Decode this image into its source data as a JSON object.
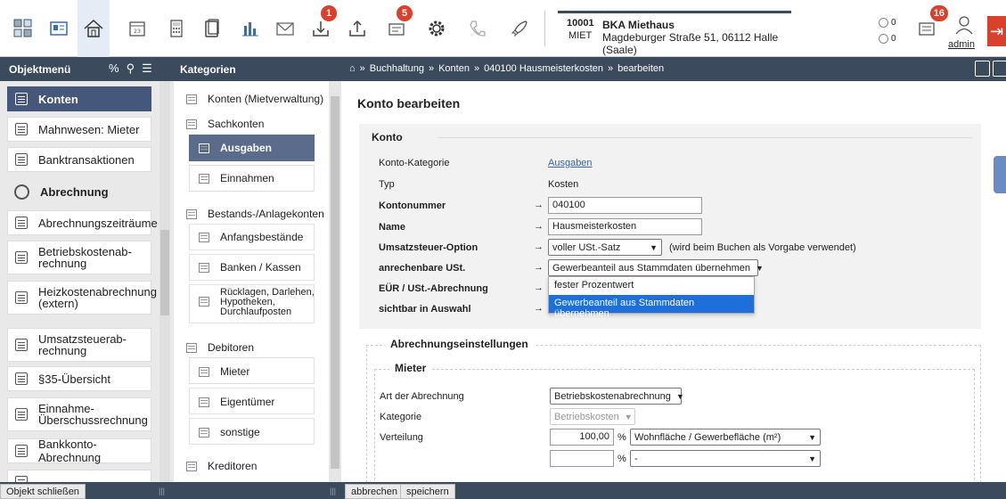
{
  "toolbar": {
    "badges": {
      "upload": "1",
      "messages": "5",
      "notifications": "16"
    },
    "object": {
      "number": "10001",
      "type": "MIET",
      "name": "BKA Miethaus",
      "address": "Magdeburger Straße 51, 06112 Halle (Saale)"
    },
    "counters": {
      "first": "0",
      "second": "0"
    },
    "user": "admin"
  },
  "headerbar": {
    "objektmenu": "Objektmenü",
    "kategorien": "Kategorien",
    "breadcrumb": [
      "Buchhaltung",
      "Konten",
      "040100 Hausmeisterkosten",
      "bearbeiten"
    ],
    "breadcrumb_sep": "»"
  },
  "leftmenu": {
    "items": [
      {
        "label": "Konten"
      },
      {
        "label": "Mahnwesen: Mieter"
      },
      {
        "label": "Banktransaktionen"
      },
      {
        "label": "Abrechnung"
      },
      {
        "label": "Abrechnungszeiträume"
      },
      {
        "label": "Betriebskostenab-\nrechnung"
      },
      {
        "label": "Heizkostenabrechnung\n(extern)"
      },
      {
        "label": "Umsatzsteuerab-\nrechnung"
      },
      {
        "label": "§35-Übersicht"
      },
      {
        "label": "Einnahme-\nÜberschussrechnung"
      },
      {
        "label": "Bankkonto-Abrechnung"
      }
    ]
  },
  "categories": {
    "items": [
      {
        "label": "Konten (Mietverwaltung)"
      },
      {
        "label": "Sachkonten"
      },
      {
        "label": "Ausgaben"
      },
      {
        "label": "Einnahmen"
      },
      {
        "label": "Bestands-/Anlagekonten"
      },
      {
        "label": "Anfangsbestände"
      },
      {
        "label": "Banken / Kassen"
      },
      {
        "label": "Rücklagen, Darlehen,\nHypotheken,\nDurchlaufposten"
      },
      {
        "label": "Debitoren"
      },
      {
        "label": "Mieter"
      },
      {
        "label": "Eigentümer"
      },
      {
        "label": "sonstige"
      },
      {
        "label": "Kreditoren"
      }
    ]
  },
  "main": {
    "title": "Konto bearbeiten",
    "konto": {
      "legend": "Konto",
      "kategorie_label": "Konto-Kategorie",
      "kategorie_value": "Ausgaben",
      "typ_label": "Typ",
      "typ_value": "Kosten",
      "kontonummer_label": "Kontonummer",
      "kontonummer_value": "040100",
      "name_label": "Name",
      "name_value": "Hausmeisterkosten",
      "ust_option_label": "Umsatzsteuer-Option",
      "ust_option_value": "voller USt.-Satz",
      "ust_option_hint": "(wird beim Buchen als Vorgabe verwendet)",
      "anrechenbar_label": "anrechenbare USt.",
      "anrechenbar_value": "Gewerbeanteil aus Stammdaten übernehmen",
      "eur_label": "EÜR / USt.-Abrechnung",
      "sichtbar_label": "sichtbar in Auswahl",
      "arrow": "→",
      "dropdown_options": [
        "fester Prozentwert",
        "Gewerbeanteil aus Stammdaten übernehmen"
      ]
    },
    "abrechnung": {
      "legend": "Abrechnungseinstellungen",
      "mieter_legend": "Mieter",
      "art_label": "Art der Abrechnung",
      "art_value": "Betriebskostenabrechnung",
      "kategorie_label": "Kategorie",
      "kategorie_value": "Betriebskosten",
      "verteilung_label": "Verteilung",
      "verteilung_percent_1": "100,00",
      "percent_sign": "%",
      "verteilung_key_1": "Wohnfläche / Gewerbefläche (m²)",
      "verteilung_percent_2": "",
      "verteilung_key_2": "-"
    }
  },
  "bottombar": {
    "close_label": "Objekt schließen",
    "cancel_label": "abbrechen",
    "save_label": "speichern"
  },
  "colors": {
    "header": "#3b4a5c",
    "active_menu": "#45577a",
    "badge": "#d9412c",
    "dropdown_highlight": "#1e6fd9"
  }
}
